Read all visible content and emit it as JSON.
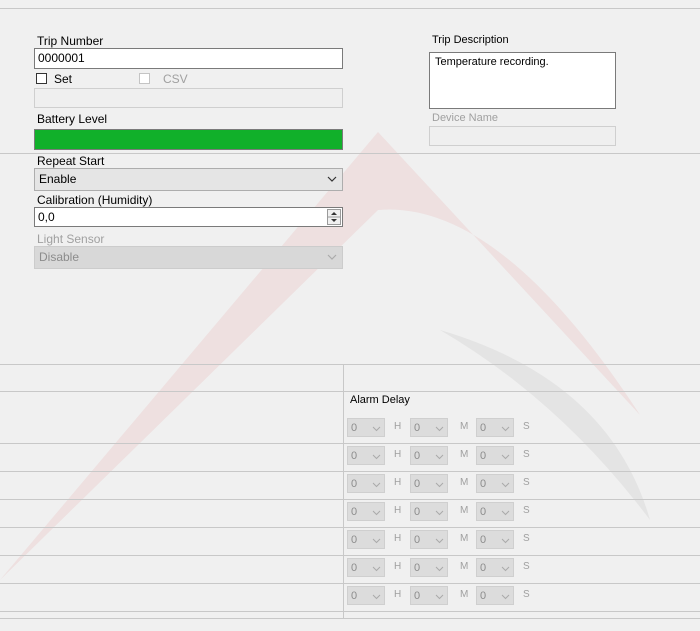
{
  "trip_number": {
    "label": "Trip Number",
    "value": "0000001"
  },
  "set_checkbox": {
    "label": "Set",
    "checked": false
  },
  "csv_checkbox": {
    "label": "CSV",
    "checked": false,
    "disabled": true
  },
  "battery": {
    "label": "Battery Level",
    "level_percent": 100,
    "color": "#11b02a"
  },
  "trip_description": {
    "label": "Trip Description",
    "value": "Temperature recording."
  },
  "device_name": {
    "label": "Device Name",
    "value": ""
  },
  "repeat_start": {
    "label": "Repeat Start",
    "value": "Enable"
  },
  "calibration": {
    "label": "Calibration (Humidity)",
    "value": "0,0"
  },
  "light_sensor": {
    "label": "Light Sensor",
    "value": "Disable"
  },
  "alarm_delay": {
    "label": "Alarm Delay",
    "units": {
      "h": "H",
      "m": "M",
      "s": "S"
    },
    "rows": [
      {
        "h": "0",
        "m": "0",
        "s": "0"
      },
      {
        "h": "0",
        "m": "0",
        "s": "0"
      },
      {
        "h": "0",
        "m": "0",
        "s": "0"
      },
      {
        "h": "0",
        "m": "0",
        "s": "0"
      },
      {
        "h": "0",
        "m": "0",
        "s": "0"
      },
      {
        "h": "0",
        "m": "0",
        "s": "0"
      },
      {
        "h": "0",
        "m": "0",
        "s": "0"
      }
    ]
  }
}
